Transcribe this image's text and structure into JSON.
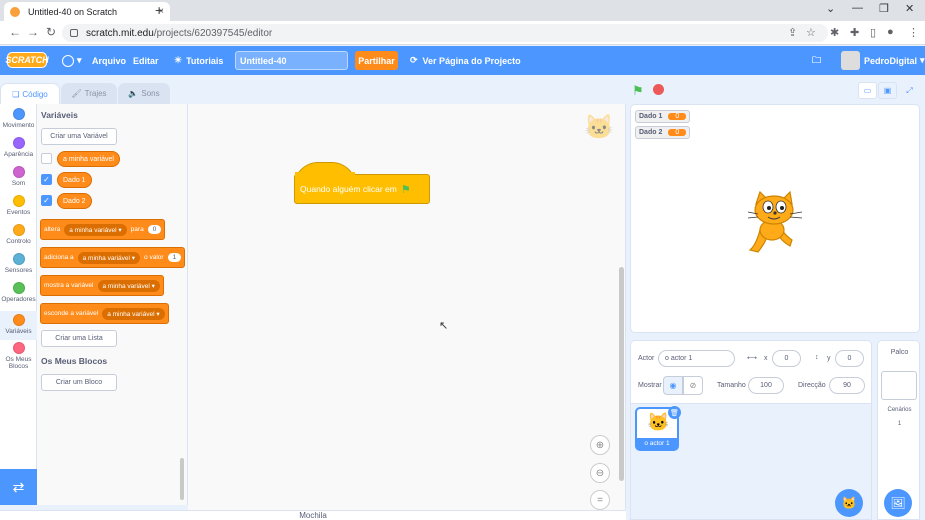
{
  "browser": {
    "tab_title": "Untitled-40 on Scratch",
    "close": "×",
    "new_tab": "+",
    "url_host": "scratch.mit.edu",
    "url_path": "/projects/620397545/editor",
    "win_min": "⌄",
    "win_minimize": "—",
    "win_max": "❐",
    "win_close": "✕",
    "back": "←",
    "forward": "→",
    "reload": "↻"
  },
  "menu": {
    "logo": "SCRATCH",
    "file": "Arquivo",
    "edit": "Editar",
    "tutorials": "Tutoriais",
    "project_title": "Untitled-40",
    "share": "Partilhar",
    "see_project": "Ver Página do Projecto",
    "username": "PedroDigital"
  },
  "editor_tabs": {
    "code": "Código",
    "costumes": "Trajes",
    "sounds": "Sons"
  },
  "categories": [
    {
      "label": "Movimento",
      "color": "#4c97ff"
    },
    {
      "label": "Aparência",
      "color": "#9966ff"
    },
    {
      "label": "Som",
      "color": "#cf63cf"
    },
    {
      "label": "Eventos",
      "color": "#ffbf00"
    },
    {
      "label": "Controlo",
      "color": "#ffab19"
    },
    {
      "label": "Sensores",
      "color": "#5cb1d6"
    },
    {
      "label": "Operadores",
      "color": "#59c059"
    },
    {
      "label": "Variáveis",
      "color": "#ff8c1a"
    },
    {
      "label": "Os Meus Blocos",
      "color": "#ff6680"
    }
  ],
  "palette": {
    "section_title": "Variáveis",
    "make_variable": "Criar uma Variável",
    "variables": [
      {
        "name": "a minha variável",
        "checked": false
      },
      {
        "name": "Dado 1",
        "checked": true
      },
      {
        "name": "Dado 2",
        "checked": true
      }
    ],
    "block_set": {
      "label": "altera",
      "var": "a minha variável",
      "to": "para",
      "value": "0"
    },
    "block_change": {
      "label": "adiciona a",
      "var": "a minha variável",
      "by": "o valor",
      "value": "1"
    },
    "block_show": {
      "label": "mostra a variável",
      "var": "a minha variável"
    },
    "block_hide": {
      "label": "esconde a variável",
      "var": "a minha variável"
    },
    "make_list": "Criar uma Lista",
    "myblocks_title": "Os Meus Blocos",
    "make_block": "Criar um Bloco"
  },
  "script": {
    "hat_block": "Quando alguém clicar em"
  },
  "backpack": "Mochila",
  "stage": {
    "monitors": [
      {
        "label": "Dado 1",
        "value": "0"
      },
      {
        "label": "Dado 2",
        "value": "0"
      }
    ]
  },
  "sprite_info": {
    "sprite_label": "Actor",
    "sprite_name": "o actor 1",
    "x_label": "x",
    "x_value": "0",
    "y_label": "y",
    "y_value": "0",
    "show_label": "Mostrar",
    "size_label": "Tamanho",
    "size_value": "100",
    "direction_label": "Direcção",
    "direction_value": "90"
  },
  "sprites": [
    {
      "name": "o actor 1"
    }
  ],
  "stage_panel": {
    "title": "Palco",
    "backdrops_label": "Cenários",
    "backdrops_count": "1"
  }
}
